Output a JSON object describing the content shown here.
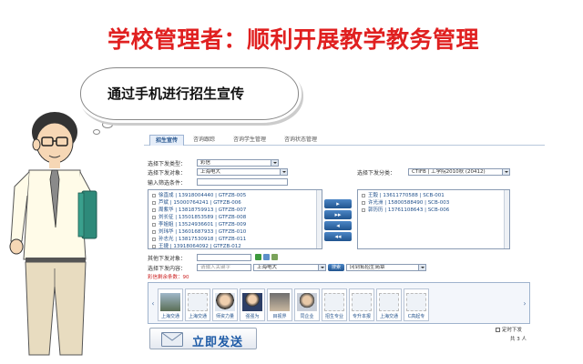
{
  "slide": {
    "title": "学校管理者：顺利开展教学教务管理",
    "bubble_text": "通过手机进行招生宣传"
  },
  "app": {
    "tabs": [
      {
        "label": "招生宣传",
        "active": true
      },
      {
        "label": "咨询跟踪",
        "active": false
      },
      {
        "label": "咨询学生管理",
        "active": false
      },
      {
        "label": "咨询状态管理",
        "active": false
      }
    ],
    "form": {
      "send_type_label": "选择下发类型：",
      "send_type_value": "彩信",
      "send_object_label": "选择下发对象：",
      "send_object_value": "上海电大",
      "filter_label": "输入筛选条件：",
      "group_label": "选择下发分类：",
      "group_value": "CTIFB | 工学院2010秋 (20412)"
    },
    "candidates": [
      "徐直成 | 13918004440 | GTFZB-005",
      "芦斌 | 15000764241 | GTFZB-006",
      "周紫华 | 13818759913 | GTFZB-007",
      "刘长征 | 13501853589 | GTFZB-008",
      "李姐姐 | 13524936601 | GTFZB-009",
      "刘玮华 | 13601687933 | GTFZB-010",
      "孙志光 | 13817530918 | GTFZB-011",
      "王捷 | 13918064092 | GTFZB-012"
    ],
    "selected": [
      "王毅 | 13611770588 | SCB-001",
      "许光洲 | 15800588490 | SCB-003",
      "郭历历 | 13761108643 | SCB-006"
    ],
    "move_buttons": [
      "▸",
      "▸▸",
      "◂",
      "◂◂"
    ],
    "other_recipients_label": "其他下发对象：",
    "content_label": "选择下发内容：",
    "content_placeholder": "请输入关键字",
    "content_select": "上海电大",
    "content_button": "搜索",
    "content_type_select": "冈到拓招生简章",
    "remaining_text": "彩信剩余条数：90",
    "templates": [
      {
        "caption": "上海交通"
      },
      {
        "caption": "上海交通"
      },
      {
        "caption": "师资力量"
      },
      {
        "caption": "强强为"
      },
      {
        "caption": "目视界"
      },
      {
        "caption": "同企业"
      },
      {
        "caption": "招生专业"
      },
      {
        "caption": "专升本报"
      },
      {
        "caption": "上海交通"
      },
      {
        "caption": "C高起专"
      }
    ],
    "schedule_label": "定时下发",
    "total_text": "共 3 人",
    "send_label": "立即发送"
  }
}
